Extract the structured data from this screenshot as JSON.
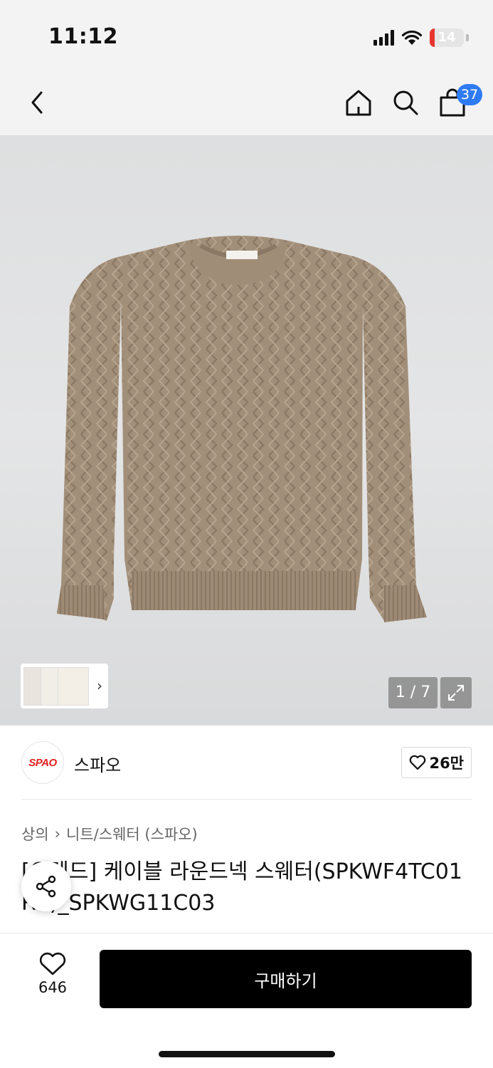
{
  "status_bar": {
    "time": "11:12",
    "battery_level": "14",
    "battery_fill_fraction": 0.14
  },
  "nav": {
    "cart_count": "37"
  },
  "gallery": {
    "current_page": "1 / 7",
    "colors": {
      "sweater": "#a18e78",
      "sweater_dark": "#8a7764",
      "background": "#e1e2e3"
    }
  },
  "brand": {
    "logo_text": "SPAO",
    "name": "스파오",
    "likes": "26만",
    "logo_color": "#e02020"
  },
  "breadcrumb": {
    "level1": "상의",
    "level2": "니트/스웨터 (스파오)"
  },
  "product": {
    "title": "[오렌드] 케이블 라운드넥 스웨터(SPKWF4TC01 RE)_SPKWG11C03"
  },
  "bottom_bar": {
    "wish_count": "646",
    "buy_label": "구매하기"
  }
}
